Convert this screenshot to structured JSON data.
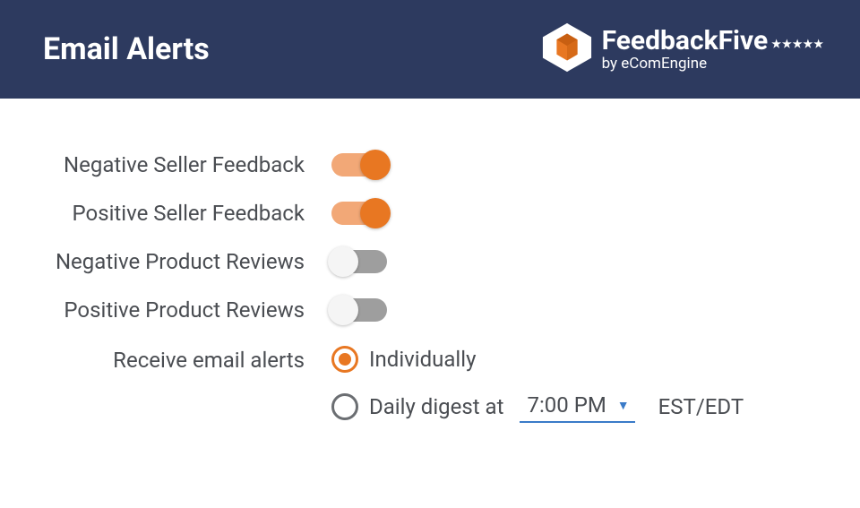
{
  "header": {
    "title": "Email Alerts",
    "logo": {
      "brand": "FeedbackFive",
      "tagline": "by eComEngine",
      "stars": "★★★★★"
    }
  },
  "colors": {
    "header_bg": "#2d3a5f",
    "accent": "#e87722",
    "link": "#3a7bc8",
    "text": "#4a4d52"
  },
  "settings": {
    "rows": [
      {
        "label": "Negative Seller Feedback",
        "state": "on"
      },
      {
        "label": "Positive Seller Feedback",
        "state": "on"
      },
      {
        "label": "Negative Product Reviews",
        "state": "off"
      },
      {
        "label": "Positive Product Reviews",
        "state": "off"
      }
    ],
    "receive": {
      "label": "Receive email alerts",
      "options": {
        "individually": {
          "label": "Individually",
          "selected": true
        },
        "digest": {
          "label": "Daily digest at",
          "selected": false,
          "time": "7:00 PM",
          "timezone": "EST/EDT"
        }
      }
    }
  }
}
